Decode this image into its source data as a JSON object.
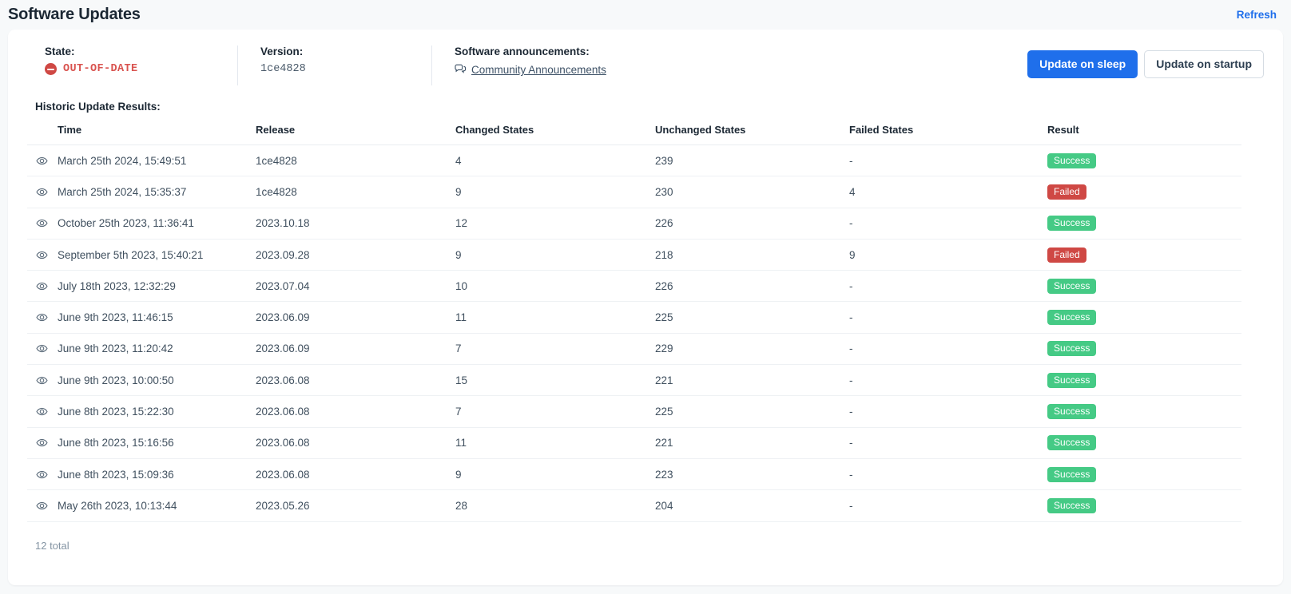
{
  "header": {
    "title": "Software Updates",
    "refresh_label": "Refresh"
  },
  "summary": {
    "state": {
      "label": "State:",
      "value": "OUT-OF-DATE",
      "icon": "minus-circle-icon",
      "color": "#cf4844"
    },
    "version": {
      "label": "Version:",
      "value": "1ce4828"
    },
    "announcements": {
      "label": "Software announcements:",
      "link_label": "Community Announcements",
      "icon": "comments-icon"
    }
  },
  "actions": {
    "update_on_sleep": "Update on sleep",
    "update_on_startup": "Update on startup",
    "primary_color": "#1f6feb"
  },
  "table": {
    "caption": "Historic Update Results:",
    "columns": [
      "Time",
      "Release",
      "Changed States",
      "Unchanged States",
      "Failed States",
      "Result"
    ],
    "row_icon": "eye-icon",
    "footer": "12 total",
    "rows": [
      {
        "time": "March 25th 2024, 15:49:51",
        "release": "1ce4828",
        "changed": "4",
        "unchanged": "239",
        "failed": "-",
        "result": "Success"
      },
      {
        "time": "March 25th 2024, 15:35:37",
        "release": "1ce4828",
        "changed": "9",
        "unchanged": "230",
        "failed": "4",
        "result": "Failed"
      },
      {
        "time": "October 25th 2023, 11:36:41",
        "release": "2023.10.18",
        "changed": "12",
        "unchanged": "226",
        "failed": "-",
        "result": "Success"
      },
      {
        "time": "September 5th 2023, 15:40:21",
        "release": "2023.09.28",
        "changed": "9",
        "unchanged": "218",
        "failed": "9",
        "result": "Failed"
      },
      {
        "time": "July 18th 2023, 12:32:29",
        "release": "2023.07.04",
        "changed": "10",
        "unchanged": "226",
        "failed": "-",
        "result": "Success"
      },
      {
        "time": "June 9th 2023, 11:46:15",
        "release": "2023.06.09",
        "changed": "11",
        "unchanged": "225",
        "failed": "-",
        "result": "Success"
      },
      {
        "time": "June 9th 2023, 11:20:42",
        "release": "2023.06.09",
        "changed": "7",
        "unchanged": "229",
        "failed": "-",
        "result": "Success"
      },
      {
        "time": "June 9th 2023, 10:00:50",
        "release": "2023.06.08",
        "changed": "15",
        "unchanged": "221",
        "failed": "-",
        "result": "Success"
      },
      {
        "time": "June 8th 2023, 15:22:30",
        "release": "2023.06.08",
        "changed": "7",
        "unchanged": "225",
        "failed": "-",
        "result": "Success"
      },
      {
        "time": "June 8th 2023, 15:16:56",
        "release": "2023.06.08",
        "changed": "11",
        "unchanged": "221",
        "failed": "-",
        "result": "Success"
      },
      {
        "time": "June 8th 2023, 15:09:36",
        "release": "2023.06.08",
        "changed": "9",
        "unchanged": "223",
        "failed": "-",
        "result": "Success"
      },
      {
        "time": "May 26th 2023, 10:13:44",
        "release": "2023.05.26",
        "changed": "28",
        "unchanged": "204",
        "failed": "-",
        "result": "Success"
      }
    ]
  }
}
